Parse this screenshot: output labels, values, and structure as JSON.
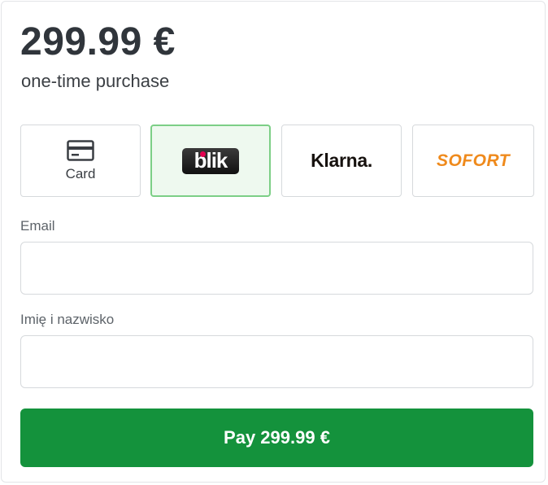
{
  "summary": {
    "price": "299.99 €",
    "subtitle": "one-time purchase"
  },
  "payment_methods": [
    {
      "id": "card",
      "label": "Card",
      "icon": "credit-card-icon",
      "selected": false
    },
    {
      "id": "blik",
      "label": "blik",
      "icon": "blik-logo",
      "selected": true
    },
    {
      "id": "klarna",
      "label": "Klarna.",
      "icon": "klarna-logo",
      "selected": false
    },
    {
      "id": "sofort",
      "label": "SOFORT",
      "icon": "sofort-logo",
      "selected": false
    }
  ],
  "form": {
    "email_label": "Email",
    "email_value": "",
    "email_placeholder": "",
    "name_label": "Imię i nazwisko",
    "name_value": "",
    "name_placeholder": ""
  },
  "pay_button": {
    "label": "Pay 299.99 €"
  },
  "colors": {
    "accent": "#14923c",
    "selected_border": "#7ccf86",
    "selected_bg": "#eef9ef",
    "blik_dot": "#e3004f",
    "sofort": "#ef8a1c"
  }
}
